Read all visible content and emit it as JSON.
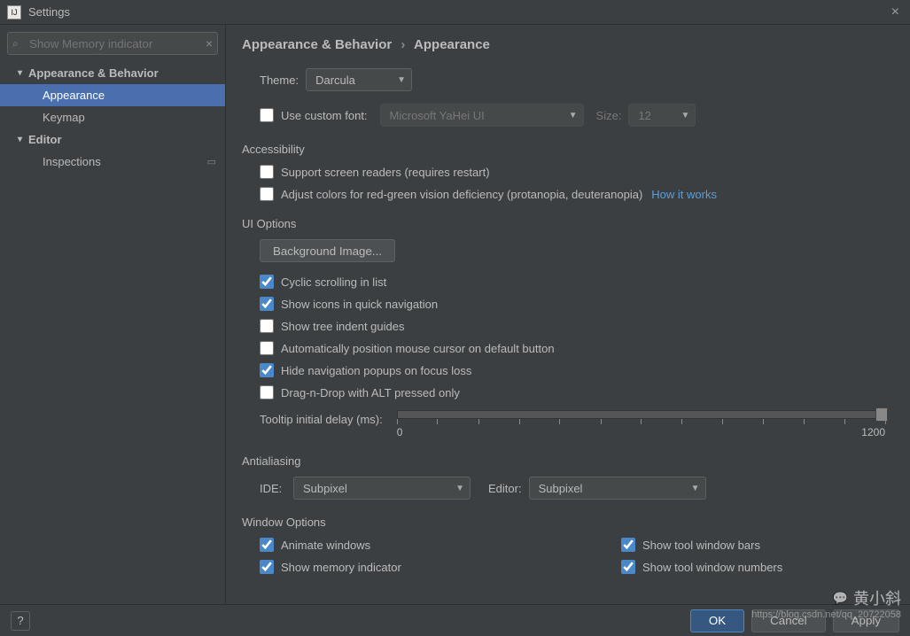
{
  "window": {
    "title": "Settings"
  },
  "search": {
    "placeholder": "Show Memory indicator"
  },
  "tree": {
    "appearance_behavior": "Appearance & Behavior",
    "appearance": "Appearance",
    "keymap": "Keymap",
    "editor": "Editor",
    "inspections": "Inspections"
  },
  "breadcrumb": {
    "a": "Appearance & Behavior",
    "b": "Appearance"
  },
  "theme": {
    "label": "Theme:",
    "value": "Darcula"
  },
  "customfont": {
    "label": "Use custom font:",
    "font": "Microsoft YaHei UI",
    "size_label": "Size:",
    "size": "12"
  },
  "accessibility": {
    "heading": "Accessibility",
    "screen_readers": "Support screen readers (requires restart)",
    "adjust_colors": "Adjust colors for red-green vision deficiency (protanopia, deuteranopia)",
    "how": "How it works"
  },
  "uioptions": {
    "heading": "UI Options",
    "bg_image": "Background Image...",
    "cyclic": "Cyclic scrolling in list",
    "show_icons": "Show icons in quick navigation",
    "tree_indent": "Show tree indent guides",
    "auto_mouse": "Automatically position mouse cursor on default button",
    "hide_nav": "Hide navigation popups on focus loss",
    "dnd_alt": "Drag-n-Drop with ALT pressed only",
    "tooltip_label": "Tooltip initial delay (ms):",
    "tooltip_min": "0",
    "tooltip_max": "1200"
  },
  "antialiasing": {
    "heading": "Antialiasing",
    "ide_label": "IDE:",
    "ide_value": "Subpixel",
    "editor_label": "Editor:",
    "editor_value": "Subpixel"
  },
  "window_options": {
    "heading": "Window Options",
    "animate": "Animate windows",
    "memory": "Show memory indicator",
    "tool_bars": "Show tool window bars",
    "tool_numbers": "Show tool window numbers"
  },
  "footer": {
    "ok": "OK",
    "cancel": "Cancel",
    "apply": "Apply"
  },
  "watermark": {
    "name": "黄小斜",
    "url": "https://blog.csdn.net/qq_20722058"
  }
}
